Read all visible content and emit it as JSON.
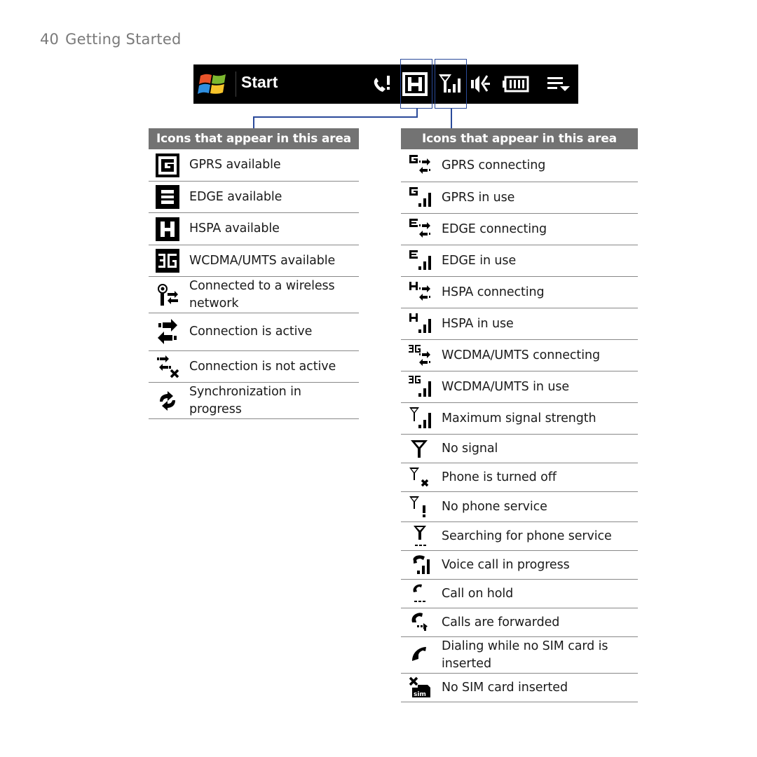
{
  "page": {
    "number": "40",
    "section": "Getting Started"
  },
  "taskbar": {
    "start_label": "Start",
    "icons": [
      "windows-logo-icon",
      "call-alert-icon",
      "hspa-icon",
      "signal-strength-icon",
      "speaker-icon",
      "battery-icon",
      "menu-dropdown-icon"
    ]
  },
  "left_table": {
    "header": "Icons that appear in this area",
    "rows": [
      {
        "icon": "gprs-available-icon",
        "label": "GPRS available"
      },
      {
        "icon": "edge-available-icon",
        "label": "EDGE available"
      },
      {
        "icon": "hspa-available-icon",
        "label": "HSPA available"
      },
      {
        "icon": "wcdma-available-icon",
        "label": "WCDMA/UMTS available"
      },
      {
        "icon": "wireless-network-icon",
        "label": "Connected to a wireless network"
      },
      {
        "icon": "connection-active-icon",
        "label": "Connection is active"
      },
      {
        "icon": "connection-inactive-icon",
        "label": "Connection is not active"
      },
      {
        "icon": "sync-icon",
        "label": "Synchronization in progress"
      }
    ]
  },
  "right_table": {
    "header": "Icons that appear in this area",
    "rows": [
      {
        "icon": "gprs-connecting-icon",
        "label": "GPRS connecting"
      },
      {
        "icon": "gprs-in-use-icon",
        "label": "GPRS in use"
      },
      {
        "icon": "edge-connecting-icon",
        "label": "EDGE connecting"
      },
      {
        "icon": "edge-in-use-icon",
        "label": "EDGE in use"
      },
      {
        "icon": "hspa-connecting-icon",
        "label": "HSPA connecting"
      },
      {
        "icon": "hspa-in-use-icon",
        "label": "HSPA in use"
      },
      {
        "icon": "wcdma-connecting-icon",
        "label": "WCDMA/UMTS connecting"
      },
      {
        "icon": "wcdma-in-use-icon",
        "label": "WCDMA/UMTS in use"
      },
      {
        "icon": "max-signal-icon",
        "label": "Maximum signal strength"
      },
      {
        "icon": "no-signal-icon",
        "label": "No signal"
      },
      {
        "icon": "phone-off-icon",
        "label": "Phone is turned off"
      },
      {
        "icon": "no-service-icon",
        "label": "No phone service"
      },
      {
        "icon": "searching-service-icon",
        "label": "Searching for phone service"
      },
      {
        "icon": "voice-call-icon",
        "label": "Voice call in progress"
      },
      {
        "icon": "call-hold-icon",
        "label": "Call on hold"
      },
      {
        "icon": "call-forward-icon",
        "label": "Calls are forwarded"
      },
      {
        "icon": "dialing-no-sim-icon",
        "label": "Dialing while no SIM card is inserted"
      },
      {
        "icon": "no-sim-icon",
        "label": "No SIM card inserted"
      }
    ]
  },
  "colors": {
    "header_bg": "#737373",
    "callout": "#2a4a9a",
    "taskbar_bg": "#000000",
    "divider": "#888888"
  }
}
